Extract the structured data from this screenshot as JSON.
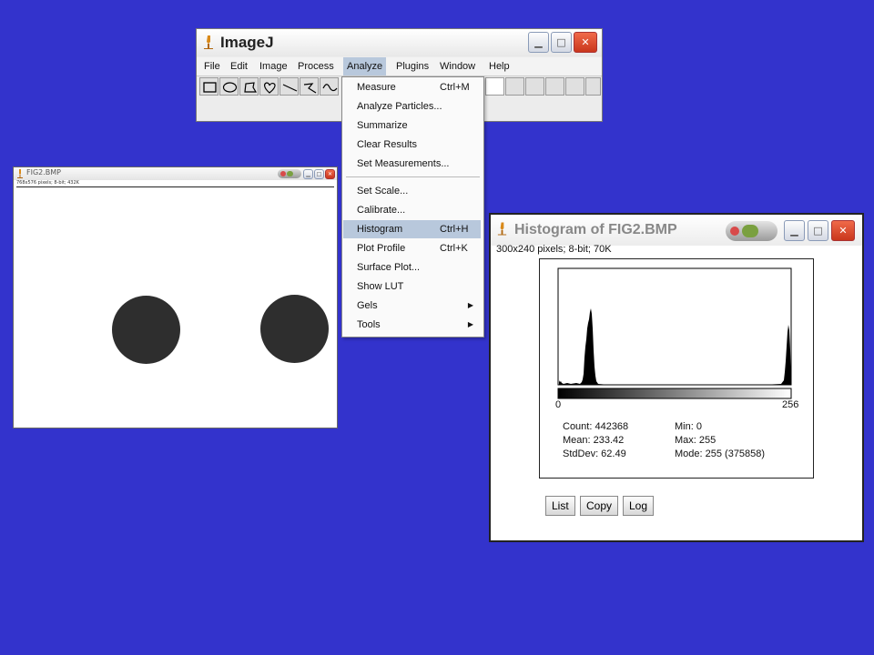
{
  "main_window": {
    "title": "ImageJ",
    "menus": [
      "File",
      "Edit",
      "Image",
      "Process",
      "Analyze",
      "Plugins",
      "Window",
      "Help"
    ],
    "active_menu": "Analyze",
    "tools": [
      "rectangle-tool-icon",
      "oval-tool-icon",
      "polygon-tool-icon",
      "freehand-tool-icon",
      "line-tool-icon",
      "segmented-line-tool-icon",
      "freehand-line-tool-icon"
    ]
  },
  "analyze_menu": {
    "items": [
      {
        "label": "Measure",
        "shortcut": "Ctrl+M"
      },
      {
        "label": "Analyze Particles...",
        "shortcut": ""
      },
      {
        "label": "Summarize",
        "shortcut": ""
      },
      {
        "label": "Clear Results",
        "shortcut": ""
      },
      {
        "label": "Set Measurements...",
        "shortcut": ""
      },
      {
        "label": "Set Scale...",
        "shortcut": ""
      },
      {
        "label": "Calibrate...",
        "shortcut": ""
      },
      {
        "label": "Histogram",
        "shortcut": "Ctrl+H"
      },
      {
        "label": "Plot Profile",
        "shortcut": "Ctrl+K"
      },
      {
        "label": "Surface Plot...",
        "shortcut": ""
      },
      {
        "label": "Show LUT",
        "shortcut": ""
      },
      {
        "label": "Gels",
        "shortcut": ""
      },
      {
        "label": "Tools",
        "shortcut": ""
      }
    ],
    "highlighted": "Histogram"
  },
  "image_window": {
    "title": "FIG2.BMP",
    "subtitle": "768x576 pixels; 8-bit; 432K"
  },
  "histogram_window": {
    "title": "Histogram of FIG2.BMP",
    "subtitle": "300x240 pixels; 8-bit; 70K",
    "axis_min": "0",
    "axis_max": "256",
    "stats": {
      "count": "Count: 442368",
      "mean": "Mean: 233.42",
      "stddev": "StdDev: 62.49",
      "min": "Min: 0",
      "max": "Max: 255",
      "mode": "Mode: 255 (375858)"
    },
    "buttons": {
      "list": "List",
      "copy": "Copy",
      "log": "Log"
    }
  },
  "colors": {
    "desktop": "#3333cc",
    "menu_highlight": "#b8c8dc",
    "close_button": "#d9472b"
  }
}
